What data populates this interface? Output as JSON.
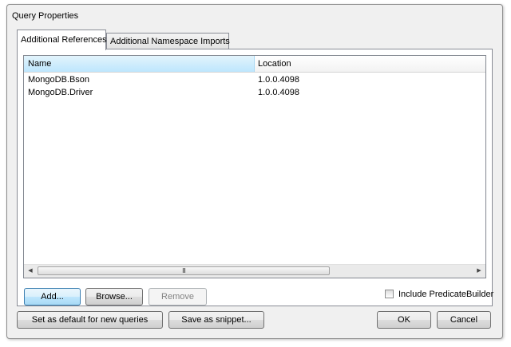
{
  "window": {
    "title": "Query Properties"
  },
  "tabs": [
    {
      "label": "Additional References",
      "active": true
    },
    {
      "label": "Additional Namespace Imports",
      "active": false
    }
  ],
  "references": {
    "columns": [
      "Name",
      "Location"
    ],
    "rows": [
      {
        "name": "MongoDB.Bson",
        "location": "1.0.0.4098"
      },
      {
        "name": "MongoDB.Driver",
        "location": "1.0.0.4098"
      }
    ],
    "scroll_thumb_glyph": "III"
  },
  "panel_buttons": {
    "add": "Add...",
    "browse": "Browse...",
    "remove": "Remove"
  },
  "include_predicate_builder": {
    "label": "Include PredicateBuilder",
    "checked": false
  },
  "footer_buttons": {
    "set_default": "Set as default for new queries",
    "save_snippet": "Save as snippet...",
    "ok": "OK",
    "cancel": "Cancel"
  },
  "icons": {
    "scroll_left": "scroll-left-arrow-icon",
    "scroll_right": "scroll-right-arrow-icon"
  }
}
